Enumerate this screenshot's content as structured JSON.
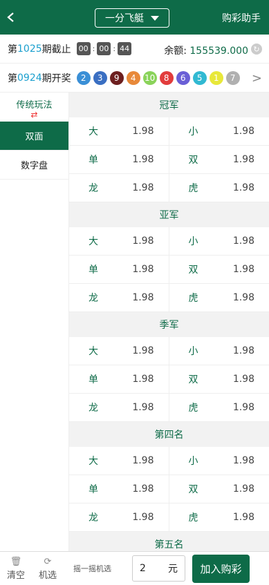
{
  "header": {
    "lottery_name": "一分飞艇",
    "helper_label": "购彩助手"
  },
  "issue": {
    "prefix": "第",
    "number": "1025",
    "suffix": "期截止",
    "timer": [
      "00",
      "00",
      "44"
    ],
    "balance_label": "余额:",
    "balance_value": "155539.000"
  },
  "draw": {
    "prefix": "第",
    "number": "0924",
    "suffix": "期开奖",
    "balls": [
      {
        "n": "2",
        "color": "#3a8fd6"
      },
      {
        "n": "3",
        "color": "#3a6fc2"
      },
      {
        "n": "9",
        "color": "#6d1f1f"
      },
      {
        "n": "4",
        "color": "#e8893a"
      },
      {
        "n": "10",
        "color": "#8ad35a"
      },
      {
        "n": "8",
        "color": "#e23c3c"
      },
      {
        "n": "6",
        "color": "#6a5fd6"
      },
      {
        "n": "5",
        "color": "#31b9d2"
      },
      {
        "n": "1",
        "color": "#e8e83a"
      },
      {
        "n": "7",
        "color": "#b0b0b0"
      }
    ]
  },
  "sidebar": {
    "heading": "传统玩法",
    "items": [
      "双面",
      "数字盘"
    ]
  },
  "sections": [
    {
      "title": "冠军",
      "rows": [
        [
          [
            "大",
            "1.98"
          ],
          [
            "小",
            "1.98"
          ]
        ],
        [
          [
            "单",
            "1.98"
          ],
          [
            "双",
            "1.98"
          ]
        ],
        [
          [
            "龙",
            "1.98"
          ],
          [
            "虎",
            "1.98"
          ]
        ]
      ]
    },
    {
      "title": "亚军",
      "rows": [
        [
          [
            "大",
            "1.98"
          ],
          [
            "小",
            "1.98"
          ]
        ],
        [
          [
            "单",
            "1.98"
          ],
          [
            "双",
            "1.98"
          ]
        ],
        [
          [
            "龙",
            "1.98"
          ],
          [
            "虎",
            "1.98"
          ]
        ]
      ]
    },
    {
      "title": "季军",
      "rows": [
        [
          [
            "大",
            "1.98"
          ],
          [
            "小",
            "1.98"
          ]
        ],
        [
          [
            "单",
            "1.98"
          ],
          [
            "双",
            "1.98"
          ]
        ],
        [
          [
            "龙",
            "1.98"
          ],
          [
            "虎",
            "1.98"
          ]
        ]
      ]
    },
    {
      "title": "第四名",
      "rows": [
        [
          [
            "大",
            "1.98"
          ],
          [
            "小",
            "1.98"
          ]
        ],
        [
          [
            "单",
            "1.98"
          ],
          [
            "双",
            "1.98"
          ]
        ],
        [
          [
            "龙",
            "1.98"
          ],
          [
            "虎",
            "1.98"
          ]
        ]
      ]
    },
    {
      "title": "第五名",
      "rows": []
    }
  ],
  "footer": {
    "clear_label": "清空",
    "random_label": "机选",
    "shake_label": "摇一摇机选",
    "amount_value": "2",
    "amount_unit": "元",
    "add_label": "加入购彩"
  }
}
